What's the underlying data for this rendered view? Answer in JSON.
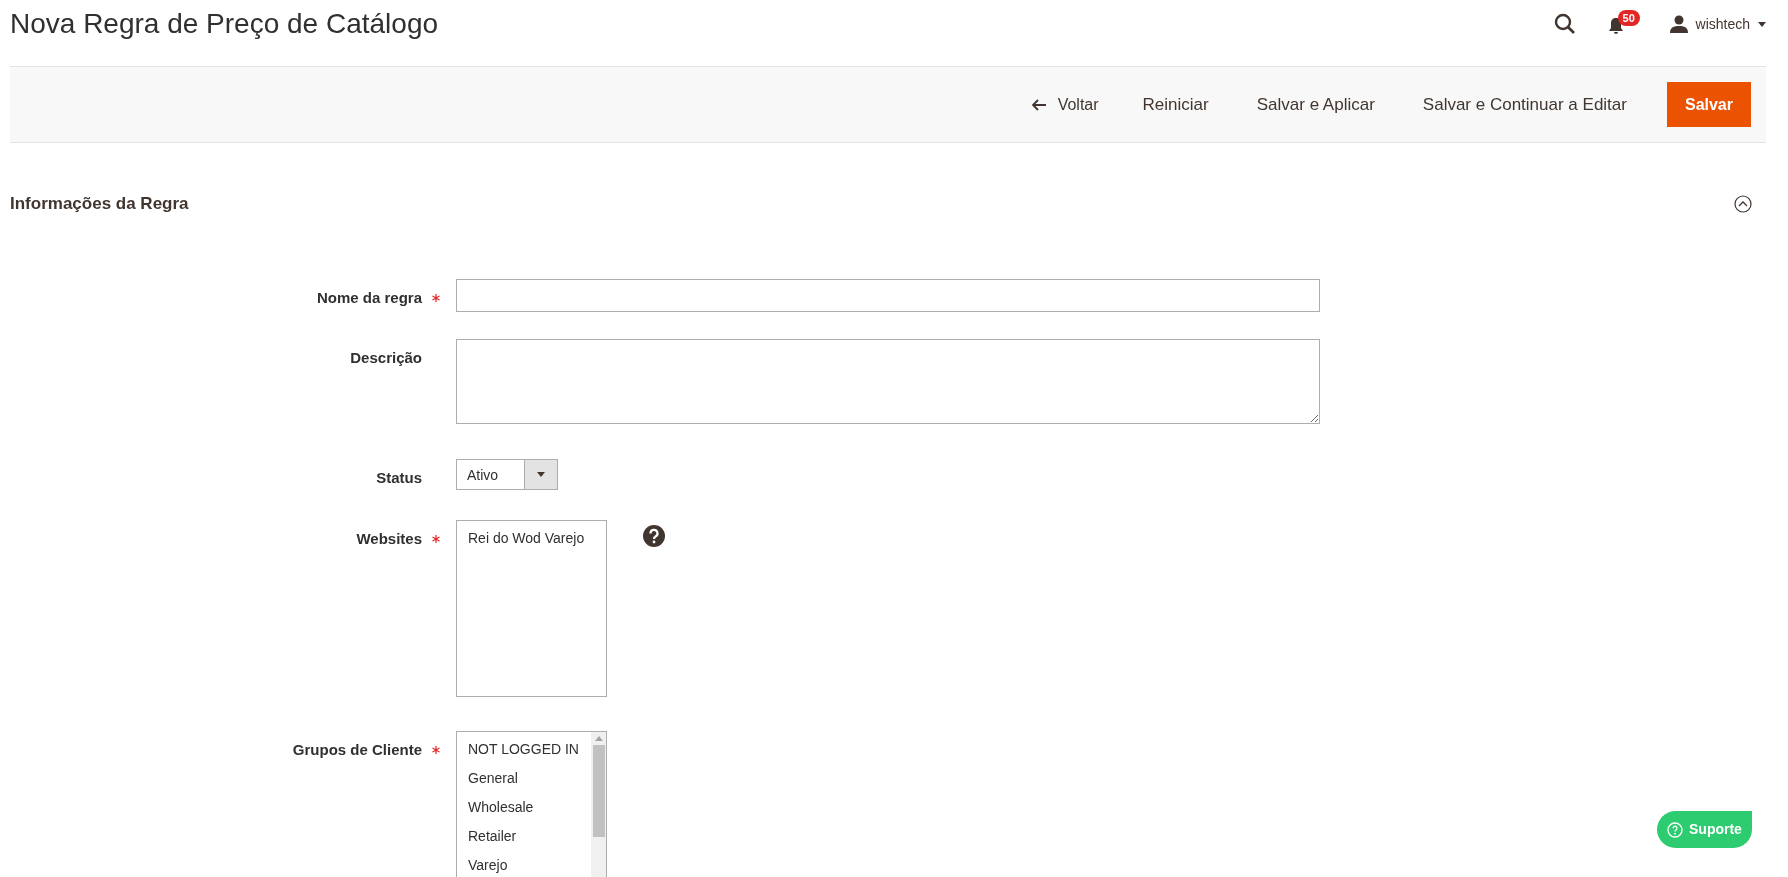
{
  "page_title": "Nova Regra de Preço de Catálogo",
  "header": {
    "notification_count": "50",
    "user": "wishtech"
  },
  "toolbar": {
    "buttons": [
      {
        "label": "Voltar",
        "kind": "back"
      },
      {
        "label": "Reiniciar",
        "kind": "plain"
      },
      {
        "label": "Salvar e Aplicar",
        "kind": "plain"
      },
      {
        "label": "Salvar e Continuar a Editar",
        "kind": "plain"
      },
      {
        "label": "Salvar",
        "kind": "primary"
      }
    ]
  },
  "section": {
    "title": "Informações da Regra",
    "expanded": true
  },
  "fields": [
    {
      "kind": "text",
      "label": "Nome da regra",
      "required": true
    },
    {
      "kind": "textarea",
      "label": "Descrição"
    },
    {
      "kind": "select",
      "label": "Status",
      "value": "Ativo"
    },
    {
      "kind": "multiselect",
      "label": "Websites",
      "required": true,
      "help": true,
      "options": [
        {
          "label": "Rei do Wod Varejo",
          "selected": false
        }
      ]
    },
    {
      "kind": "multiselect",
      "label": "Grupos de Cliente",
      "required": true,
      "scrollbar": true,
      "options": [
        {
          "label": "NOT LOGGED IN",
          "selected": false
        },
        {
          "label": "General",
          "selected": false
        },
        {
          "label": "Wholesale",
          "selected": false
        },
        {
          "label": "Retailer",
          "selected": false
        },
        {
          "label": "Varejo",
          "selected": false
        }
      ]
    }
  ],
  "support_button": "Suporte"
}
